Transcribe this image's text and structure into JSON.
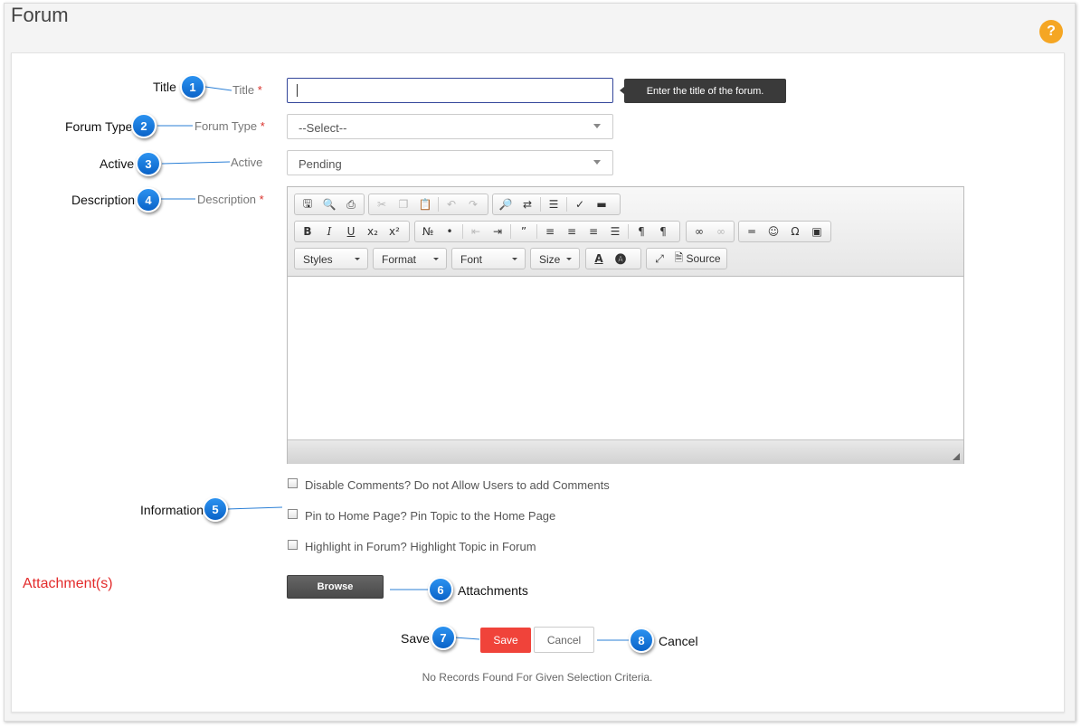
{
  "page": {
    "title": "Forum",
    "help_label": "?"
  },
  "callouts": [
    {
      "number": "1",
      "label": "Title"
    },
    {
      "number": "2",
      "label": "Forum Type"
    },
    {
      "number": "3",
      "label": "Active"
    },
    {
      "number": "4",
      "label": "Description"
    },
    {
      "number": "5",
      "label": "Information"
    },
    {
      "number": "6",
      "label": "Attachments"
    },
    {
      "number": "7",
      "label": "Save"
    },
    {
      "number": "8",
      "label": "Cancel"
    }
  ],
  "form": {
    "title_label": "Title",
    "title_value": "",
    "title_tooltip": "Enter the title of the forum.",
    "forum_type_label": "Forum Type",
    "forum_type_value": "--Select--",
    "active_label": "Active",
    "active_value": "Pending",
    "description_label": "Description",
    "required_marker": "*",
    "checkboxes": [
      {
        "label": "Disable Comments? Do not Allow Users to add Comments",
        "checked": false
      },
      {
        "label": "Pin to Home Page? Pin Topic to the Home Page",
        "checked": false
      },
      {
        "label": "Highlight in Forum? Highlight Topic in Forum",
        "checked": false
      }
    ],
    "attachments_title": "Attachment(s)",
    "browse_label": "Browse",
    "save_label": "Save",
    "cancel_label": "Cancel",
    "no_records": "No Records Found For Given Selection Criteria."
  },
  "editor": {
    "styles_label": "Styles",
    "format_label": "Format",
    "font_label": "Font",
    "size_label": "Size",
    "source_label": "Source"
  },
  "colors": {
    "badge": "#1a7ae0",
    "required": "#d9302a",
    "save_button": "#f0433a",
    "attachments_title": "#e32b2b",
    "help_button": "#f5a623"
  }
}
